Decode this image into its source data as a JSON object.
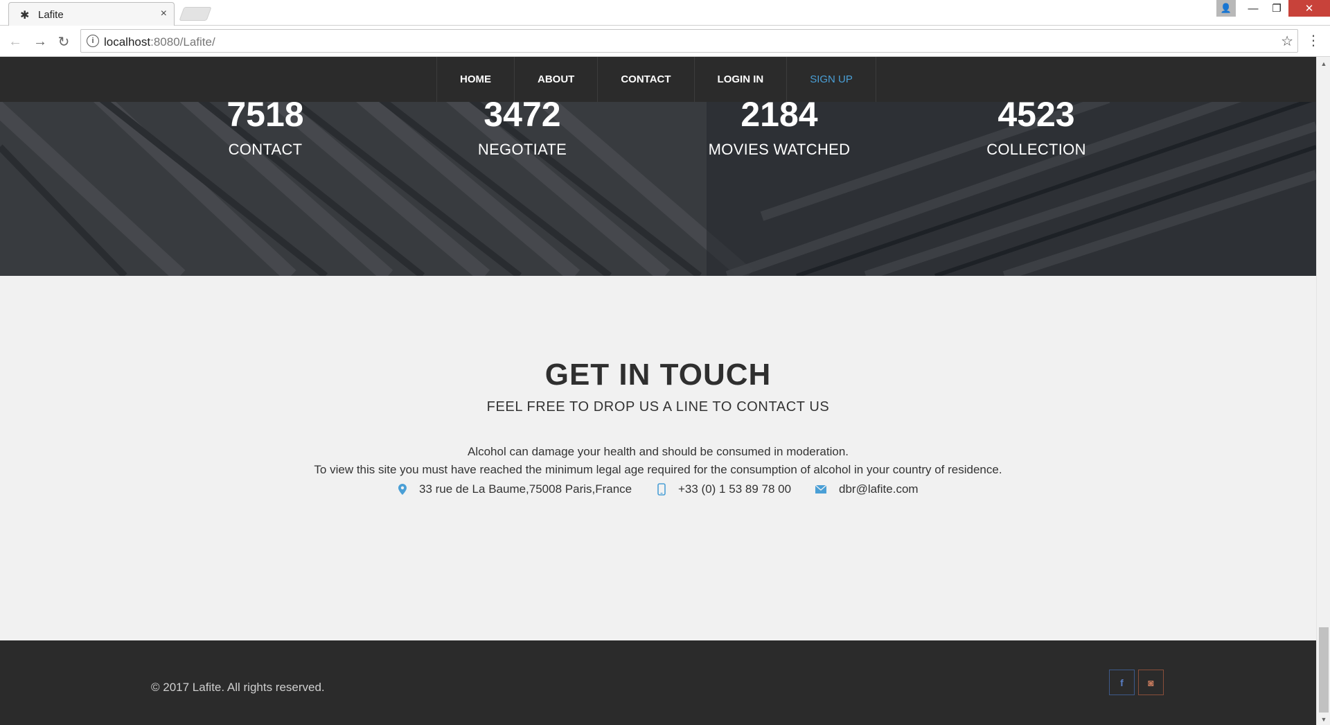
{
  "browser": {
    "tab_title": "Lafite",
    "tab_favicon": "✱",
    "tab_close": "×",
    "url_host": "localhost",
    "url_rest": ":8080/Lafite/",
    "back_glyph": "←",
    "forward_glyph": "→",
    "reload_glyph": "↻",
    "info_glyph": "i",
    "star_glyph": "☆",
    "menu_glyph": "⋮",
    "minimize_glyph": "—",
    "restore_glyph": "❐",
    "close_glyph": "✕",
    "user_glyph": "👤"
  },
  "nav": {
    "items": [
      {
        "label": "HOME"
      },
      {
        "label": "ABOUT"
      },
      {
        "label": "CONTACT"
      },
      {
        "label": "LOGIN IN"
      },
      {
        "label": "SIGN UP"
      }
    ],
    "accent_color": "#4a9fd6"
  },
  "stats": [
    {
      "value": "7518",
      "label": "CONTACT"
    },
    {
      "value": "3472",
      "label": "NEGOTIATE"
    },
    {
      "value": "2184",
      "label": "MOVIES WATCHED"
    },
    {
      "value": "4523",
      "label": "COLLECTION"
    }
  ],
  "contact": {
    "title": "GET IN TOUCH",
    "subtitle": "FEEL FREE TO DROP US A LINE TO CONTACT US",
    "line1": "Alcohol can damage your health and should be consumed in moderation.",
    "line2": "To view this site you must have reached the minimum legal age required for the consumption of alcohol in your country of residence.",
    "address": "33 rue de La Baume,75008 Paris,France",
    "phone": "+33 (0) 1 53 89 78 00",
    "email": "dbr@lafite.com",
    "address_icon": "map-pin-icon",
    "phone_icon": "mobile-phone-icon",
    "email_icon": "envelope-icon"
  },
  "footer": {
    "copyright": "© 2017 Lafite. All rights reserved.",
    "facebook_glyph": "f",
    "instagram_glyph": "◙"
  },
  "scrollbar": {
    "up_glyph": "▲",
    "down_glyph": "▼"
  }
}
